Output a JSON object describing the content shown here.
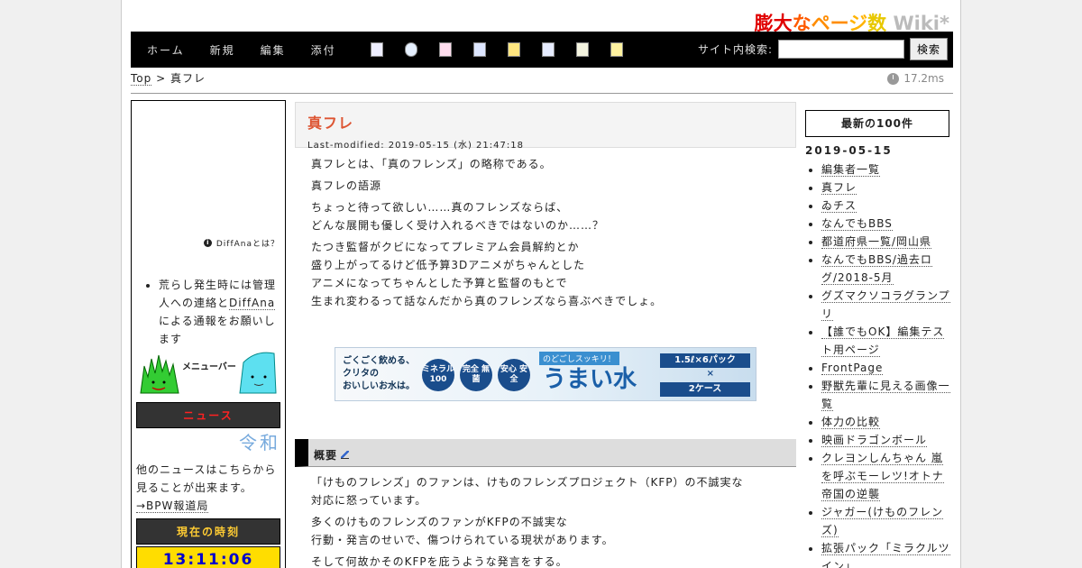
{
  "site": {
    "title_parts": [
      {
        "text": "膨大",
        "color": "#e00000"
      },
      {
        "text": "な",
        "color": "#ff5a00"
      },
      {
        "text": "ペー",
        "color": "#ff8c00"
      },
      {
        "text": "ジ",
        "color": "#ffb300"
      },
      {
        "text": "数",
        "color": "#e8c800"
      },
      {
        "text": " Wiki*",
        "color": "#bbbbbb"
      }
    ]
  },
  "navbar": {
    "items": [
      "ホーム",
      "新規",
      "編集",
      "添付"
    ],
    "icons": [
      "new-page-icon",
      "refresh-icon",
      "delete-icon",
      "save-icon",
      "lock-icon",
      "copy-icon",
      "list-icon",
      "help-icon"
    ],
    "search_label": "サイト内検索:",
    "search_placeholder": "",
    "search_button": "検索"
  },
  "breadcrumb": {
    "top": "Top",
    "separator": ">",
    "current": "真フレ"
  },
  "timing": "17.2ms",
  "left_sidebar": {
    "diffana_label": "DiffAnaとは？",
    "notice_prefix": "荒らし発生時には管理人への連絡と",
    "notice_link": "DiffAna",
    "notice_suffix": "による通報をお願いします",
    "menu_banner": "メニューバー",
    "news_header": "ニュース",
    "news_ticker": "令和",
    "news_more_text": "他のニュースはこちらから見ることが出来ます。",
    "news_more_link": "→BPW報道局",
    "time_header": "現在の時刻",
    "time_value": "13:11:06"
  },
  "main": {
    "title": "真フレ",
    "last_modified": "Last-modified: 2019-05-15 (水) 21:47:18",
    "paragraphs": [
      "真フレとは、「真のフレンズ」の略称である。",
      "真フレの語源",
      "ちょっと待って欲しい……真のフレンズならば、",
      "どんな展開も優しく受け入れるべきではないのか……？",
      "たつき監督がクビになってプレミアム会員解約とか",
      "盛り上がってるけど低予算3Dアニメがちゃんとした",
      "アニメになってちゃんとした予算と監督のもとで",
      "生まれ変わるって話なんだから真のフレンズなら喜ぶべきでしょ。"
    ],
    "banner": {
      "line1": "ごくごく飲める、",
      "line2": "クリタの",
      "line3": "おいしいお水は。",
      "circle1": "ミネラル 100",
      "circle2": "完全 無菌",
      "circle3": "安心 安全",
      "tag": "のどごしスッキリ！",
      "big": "うまい水",
      "pack": "1.5ℓ×6パック",
      "times": "×",
      "case": "2ケース"
    },
    "section_title": "概要",
    "section_paragraphs": [
      "「けものフレンズ」のファンは、けものフレンズプロジェクト（KFP）の不誠実な",
      "対応に怒っています。",
      "多くのけものフレンズのファンがKFPの不誠実な",
      "行動・発言のせいで、傷つけられている現状があります。",
      "そして何故かそのKFPを庇うような発言をする。"
    ]
  },
  "right_sidebar": {
    "header": "最新の100件",
    "date": "2019-05-15",
    "items": [
      "編集者一覧",
      "真フレ",
      "ゐチス",
      "なんでもBBS",
      "都道府県一覧/岡山県",
      "なんでもBBS/過去ログ/2018-5月",
      "グズマクソコラグランプリ",
      "【誰でもOK】編集テスト用ページ",
      "FrontPage",
      "野獣先輩に見える画像一覧",
      "体力の比較",
      "映画ドラゴンボール",
      "クレヨンしんちゃん 嵐を呼ぶモーレツ!オトナ帝国の逆襲",
      "ジャガー(けものフレンズ)",
      "拡張パック「ミラクルツイン」"
    ]
  }
}
